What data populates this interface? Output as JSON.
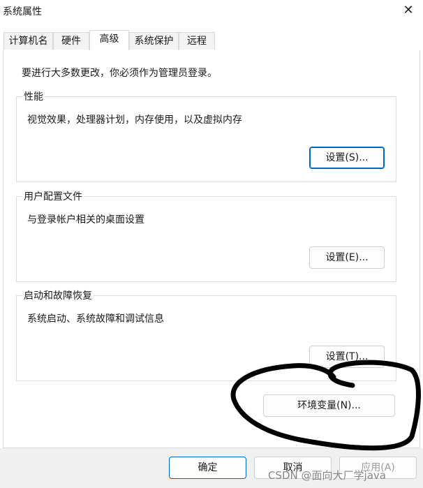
{
  "window": {
    "title": "系统属性"
  },
  "tabs": [
    {
      "label": "计算机名"
    },
    {
      "label": "硬件"
    },
    {
      "label": "高级"
    },
    {
      "label": "系统保护"
    },
    {
      "label": "远程"
    }
  ],
  "notice": "要进行大多数更改，你必须作为管理员登录。",
  "performance": {
    "label": "性能",
    "description": "视觉效果，处理器计划，内存使用，以及虚拟内存",
    "button": "设置(S)..."
  },
  "user_profiles": {
    "label": "用户配置文件",
    "description": "与登录帐户相关的桌面设置",
    "button": "设置(E)..."
  },
  "startup_recovery": {
    "label": "启动和故障恢复",
    "description": "系统启动、系统故障和调试信息",
    "button": "设置(T)..."
  },
  "env_vars": {
    "button": "环境变量(N)..."
  },
  "footer": {
    "ok": "确定",
    "cancel": "取消",
    "apply": "应用(A)"
  },
  "watermark": "CSDN @面向大厂学java",
  "colors": {
    "accent": "#0067c0",
    "annotation": "#000000"
  }
}
